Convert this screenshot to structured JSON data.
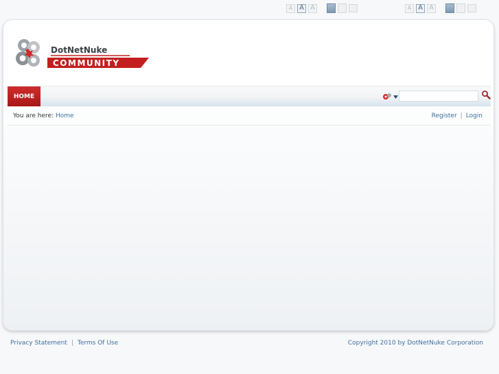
{
  "controls": {
    "font_sizes": [
      "A",
      "A",
      "A"
    ]
  },
  "nav": {
    "home_label": "HOME"
  },
  "search": {
    "value": "",
    "placeholder": ""
  },
  "breadcrumb": {
    "label": "You are here:",
    "items": [
      "Home"
    ]
  },
  "auth": {
    "register": "Register",
    "separator": "|",
    "login": "Login"
  },
  "footer": {
    "privacy": "Privacy Statement",
    "separator": "|",
    "terms": "Terms Of Use",
    "copyright": "Copyright 2010 by DotNetNuke Corporation"
  },
  "logo": {
    "line1": "DotNetNuke",
    "line2": "COMMUNITY"
  },
  "colors": {
    "brand_red": "#c41f1f",
    "link": "#3f6f9f"
  }
}
